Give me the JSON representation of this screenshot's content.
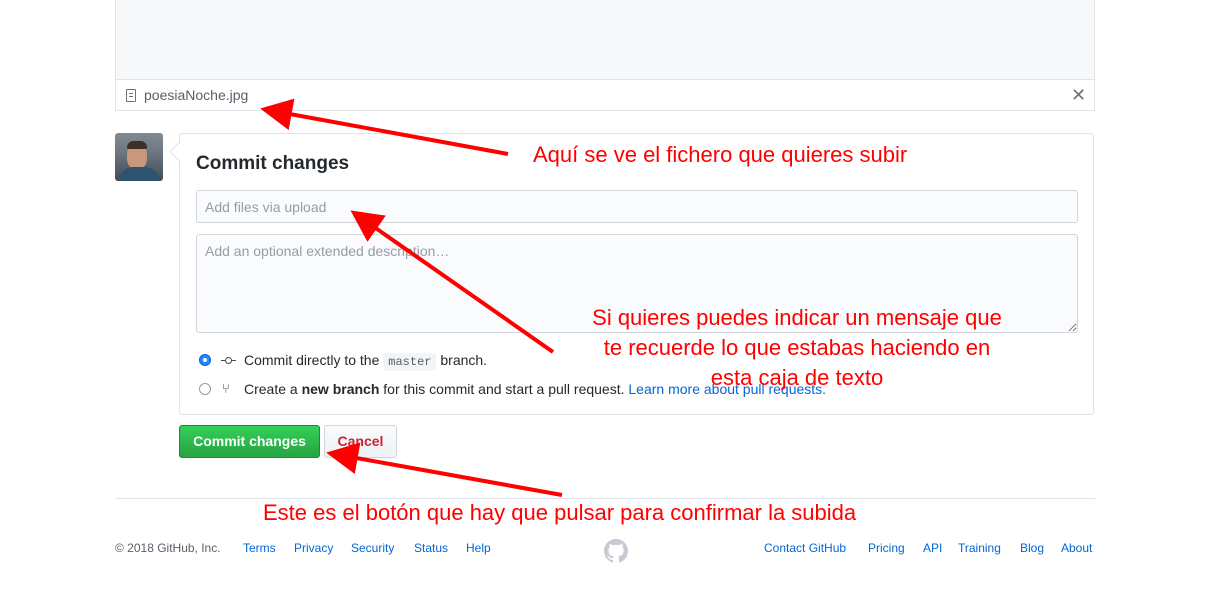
{
  "file": {
    "name": "poesiaNoche.jpg",
    "remove_glyph": "✕",
    "icon": "file-icon"
  },
  "commit": {
    "title": "Commit changes",
    "summary_placeholder": "Add files via upload",
    "description_placeholder": "Add an optional extended description…",
    "option_direct": {
      "before": "Commit directly to the",
      "branch": "master",
      "after": "branch.",
      "selected": true
    },
    "option_new_branch": {
      "prefix": "Create a",
      "bold": "new branch",
      "suffix": "for this commit and start a pull request.",
      "link": "Learn more about pull requests.",
      "selected": false
    },
    "submit_label": "Commit changes",
    "cancel_label": "Cancel"
  },
  "footer": {
    "copyright": "© 2018 GitHub, Inc.",
    "left_links": [
      "Terms",
      "Privacy",
      "Security",
      "Status",
      "Help"
    ],
    "right_links": [
      "Contact GitHub",
      "Pricing",
      "API",
      "Training",
      "Blog",
      "About"
    ],
    "logo_icon": "github-octocat-icon"
  },
  "annotations": {
    "file": "Aquí se ve el fichero que quieres subir",
    "message_lines": [
      "Si quieres puedes indicar un mensaje que",
      "te recuerde lo que estabas haciendo en",
      "esta caja de texto"
    ],
    "button": "Este es el botón que hay que pulsar para confirmar la subida"
  },
  "colors": {
    "annotation": "#ff0000",
    "link": "#0366d6",
    "commit_button": "#28a745",
    "cancel_text": "#cb2431"
  }
}
